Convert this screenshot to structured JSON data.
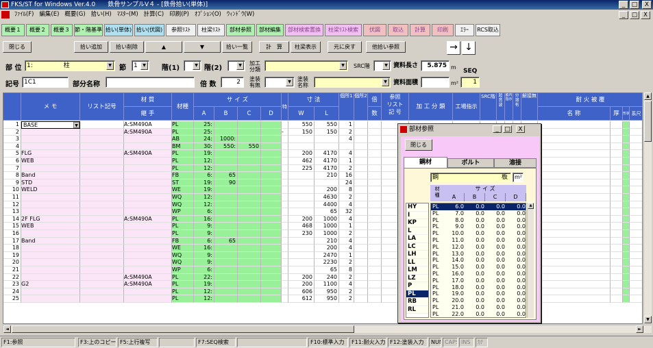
{
  "window": {
    "title": "FKS/ST for Windows Ver.4.0　　鉄骨サンプルV４ - [鉄骨拾い(単体)]",
    "controls": [
      "_",
      "□",
      "X"
    ],
    "child_controls": [
      "_",
      "□",
      "X"
    ]
  },
  "menu": [
    "ﾌｧｲﾙ(F)",
    "編集(E)",
    "概要(G)",
    "拾い(H)",
    "ﾏｽﾀｰ(M)",
    "計算(C)",
    "印刷(P)",
    "ｵﾌﾟｼｮﾝ(O)",
    "ｳｨﾝﾄﾞｳ(W)"
  ],
  "tabs": [
    {
      "label": "概要１",
      "color": "#b0f0b0"
    },
    {
      "label": "概要２",
      "color": "#b0f0b0"
    },
    {
      "label": "概要３",
      "color": "#b0f0b0"
    },
    {
      "label": "節・階基準",
      "color": "#b0f0b0"
    },
    {
      "label": "拾い(単体)",
      "color": "#b0e0f0"
    },
    {
      "label": "拾い(伏図)",
      "color": "#b0e0f0"
    },
    {
      "label": "参照ﾘｽﾄ",
      "color": "#f0f0f0"
    },
    {
      "label": "柱梁ﾘｽﾄ",
      "color": "#f0f0f0"
    },
    {
      "label": "部材参照",
      "color": "#b0f0b0"
    },
    {
      "label": "部材編集",
      "color": "#b0f0b0"
    },
    {
      "label": "部材検索置換",
      "color": "#f0c0f0"
    },
    {
      "label": "柱梁ﾘｽﾄ検索",
      "color": "#f0c0f0"
    },
    {
      "label": "伏図",
      "color": "#f0c0c0"
    },
    {
      "label": "取込",
      "color": "#f0c0c0"
    },
    {
      "label": "計算",
      "color": "#f0c0c0"
    },
    {
      "label": "印刷",
      "color": "#f0c0c0"
    },
    {
      "label": "ｴﾗｰ",
      "color": "#f0f0f0"
    },
    {
      "label": "RCS取込",
      "color": "#f0f0f0"
    }
  ],
  "toolbar": {
    "close": "閉じる",
    "add": "拾い追加",
    "delete": "拾い削除",
    "up": "▲",
    "down": "▼",
    "list": "拾い一覧",
    "calc": "計　算",
    "show": "柱梁表示",
    "undo": "元に戻す",
    "other": "他拾い参照",
    "nav_right": "→",
    "nav_down": "↓"
  },
  "form": {
    "buzai_label": "部 位",
    "buzai_value": "1:　　　　　柱",
    "setsu_label": "節",
    "setsu_value": "1",
    "kai1_label": "階(1)",
    "kai2_label": "階(2)",
    "kako_label": "加工\n分類",
    "src_label": "SRC階",
    "shiryo_len_label": "資料長さ",
    "shiryo_len_value": "5.875",
    "len_unit": "m",
    "seq_label": "SEQ",
    "seq_value": "1",
    "kigou_label": "記号",
    "kigou_value": "1C1",
    "bubun_label": "部分名称",
    "baisu_label": "倍 数",
    "baisu_value": "2",
    "tosou_label": "塗装\n有無",
    "tosou2_label": "塗装\n名称",
    "shiryo_area_label": "資料面積",
    "area_unit": "m²"
  },
  "grid": {
    "headers": {
      "memo": "メ モ",
      "list": "リスト記号",
      "zaishitsu": "材 質",
      "tsugite": "継 手",
      "zaishu": "材種",
      "size": "サ イ ズ",
      "A": "A",
      "B": "B",
      "C": "C",
      "D": "D",
      "tokui": "特",
      "sunpo": "寸 法",
      "W": "W",
      "L": "L",
      "kasho1": "個所1",
      "kasho2": "個所2",
      "bai": "倍",
      "su": "数",
      "sansho": "参照\nリスト\n記 号",
      "kako": "加 工 分 類",
      "genko": "工場指示",
      "src": "SRC階",
      "chokoku": "超音波",
      "shintai": "脇内指示",
      "bunkatsu": "分溶有",
      "kaiten": "解接無",
      "taika": "耐 火 被 覆",
      "meisho": "名 称",
      "atsu": "厚",
      "keishiki": "形状",
      "keijo": "系尺"
    },
    "rows": [
      {
        "n": "1",
        "memo": "BASE",
        "zai": "A:SM490A",
        "sh": "PL",
        "A": "25:",
        "B": "",
        "C": "",
        "D": "",
        "tk": "",
        "W": "550",
        "L": "550",
        "k1": "1"
      },
      {
        "n": "2",
        "memo": "",
        "zai": "A:SM490A",
        "sh": "PL",
        "A": "25:",
        "B": "",
        "C": "",
        "D": "",
        "tk": "-",
        "W": "150",
        "L": "150",
        "k1": "2"
      },
      {
        "n": "3",
        "memo": "",
        "zai": "",
        "sh": "AB",
        "A": "24:",
        "B": "1000:",
        "C": "",
        "D": "",
        "tk": "",
        "W": "",
        "L": "",
        "k1": "4"
      },
      {
        "n": "4",
        "memo": "",
        "zai": "",
        "sh": "BM",
        "A": "30:",
        "B": "550:",
        "C": "550",
        "D": "",
        "tk": "",
        "W": "",
        "L": "",
        "k1": ""
      },
      {
        "n": "5",
        "memo": "FLG",
        "zai": "A:SM490A",
        "sh": "PL",
        "A": "19:",
        "B": "",
        "C": "",
        "D": "",
        "tk": "",
        "W": "200",
        "L": "4170",
        "k1": "4"
      },
      {
        "n": "6",
        "memo": "WEB",
        "zai": "",
        "sh": "PL",
        "A": "12:",
        "B": "",
        "C": "",
        "D": "",
        "tk": "",
        "W": "462",
        "L": "4170",
        "k1": "1"
      },
      {
        "n": "7",
        "memo": "",
        "zai": "",
        "sh": "PL",
        "A": "12:",
        "B": "",
        "C": "",
        "D": "",
        "tk": "",
        "W": "225",
        "L": "4170",
        "k1": "2"
      },
      {
        "n": "8",
        "memo": "Band",
        "zai": "",
        "sh": "FB",
        "A": "6:",
        "B": "65",
        "C": "",
        "D": "",
        "tk": "",
        "W": "",
        "L": "210",
        "k1": "16"
      },
      {
        "n": "9",
        "memo": "STD",
        "zai": "",
        "sh": "ST",
        "A": "19:",
        "B": "90",
        "C": "",
        "D": "",
        "tk": "",
        "W": "",
        "L": "",
        "k1": "24"
      },
      {
        "n": "10",
        "memo": "WELD",
        "zai": "",
        "sh": "WE",
        "A": "19:",
        "B": "",
        "C": "",
        "D": "",
        "tk": "",
        "W": "",
        "L": "200",
        "k1": "8"
      },
      {
        "n": "11",
        "memo": "",
        "zai": "",
        "sh": "WQ",
        "A": "12:",
        "B": "",
        "C": "",
        "D": "",
        "tk": "",
        "W": "",
        "L": "4630",
        "k1": "2"
      },
      {
        "n": "12",
        "memo": "",
        "zai": "",
        "sh": "WQ",
        "A": "12:",
        "B": "",
        "C": "",
        "D": "",
        "tk": "",
        "W": "",
        "L": "4400",
        "k1": "4"
      },
      {
        "n": "13",
        "memo": "",
        "zai": "",
        "sh": "WP",
        "A": "6:",
        "B": "",
        "C": "",
        "D": "",
        "tk": "",
        "W": "",
        "L": "65",
        "k1": "32"
      },
      {
        "n": "14",
        "memo": "2F FLG",
        "zai": "A:SM490A",
        "sh": "PL",
        "A": "16:",
        "B": "",
        "C": "",
        "D": "",
        "tk": "",
        "W": "200",
        "L": "1000",
        "k1": "4"
      },
      {
        "n": "15",
        "memo": "WEB",
        "zai": "",
        "sh": "PL",
        "A": "9:",
        "B": "",
        "C": "",
        "D": "",
        "tk": "",
        "W": "468",
        "L": "1000",
        "k1": "1"
      },
      {
        "n": "16",
        "memo": "",
        "zai": "",
        "sh": "PL",
        "A": "9:",
        "B": "",
        "C": "",
        "D": "",
        "tk": "",
        "W": "230",
        "L": "1000",
        "k1": "2"
      },
      {
        "n": "17",
        "memo": "Band",
        "zai": "",
        "sh": "FB",
        "A": "6:",
        "B": "65",
        "C": "",
        "D": "",
        "tk": "",
        "W": "",
        "L": "210",
        "k1": "4"
      },
      {
        "n": "18",
        "memo": "",
        "zai": "",
        "sh": "WE",
        "A": "16:",
        "B": "",
        "C": "",
        "D": "",
        "tk": "",
        "W": "",
        "L": "200",
        "k1": "4"
      },
      {
        "n": "19",
        "memo": "",
        "zai": "",
        "sh": "WQ",
        "A": "9:",
        "B": "",
        "C": "",
        "D": "",
        "tk": "",
        "W": "",
        "L": "2470",
        "k1": "1"
      },
      {
        "n": "20",
        "memo": "",
        "zai": "",
        "sh": "WQ",
        "A": "9:",
        "B": "",
        "C": "",
        "D": "",
        "tk": "",
        "W": "",
        "L": "2230",
        "k1": "2"
      },
      {
        "n": "21",
        "memo": "",
        "zai": "",
        "sh": "WP",
        "A": "6:",
        "B": "",
        "C": "",
        "D": "",
        "tk": "",
        "W": "",
        "L": "65",
        "k1": "8"
      },
      {
        "n": "22",
        "memo": "",
        "zai": "A:SM490A",
        "sh": "PL",
        "A": "22:",
        "B": "",
        "C": "",
        "D": "",
        "tk": "",
        "W": "200",
        "L": "240",
        "k1": "2"
      },
      {
        "n": "23",
        "memo": "G2",
        "zai": "A:SM490A",
        "sh": "PL",
        "A": "19:",
        "B": "",
        "C": "",
        "D": "",
        "tk": "",
        "W": "200",
        "L": "1100",
        "k1": "4"
      },
      {
        "n": "24",
        "memo": "",
        "zai": "",
        "sh": "PL",
        "A": "12:",
        "B": "",
        "C": "",
        "D": "",
        "tk": "",
        "W": "606",
        "L": "950",
        "k1": "2"
      },
      {
        "n": "25",
        "memo": "",
        "zai": "",
        "sh": "PL",
        "A": "12:",
        "B": "",
        "C": "",
        "D": "",
        "tk": "",
        "W": "612",
        "L": "950",
        "k1": "2"
      }
    ]
  },
  "popup": {
    "title": "部材参照",
    "close": "閉じる",
    "tabs": [
      "鋼材",
      "ボルト",
      "溶接"
    ],
    "field_value": "鋼",
    "field_suffix": "板",
    "unit": "m²",
    "col_zaishu": "材\n種",
    "col_size": "サ イ ズ",
    "cols": [
      "A",
      "B",
      "C",
      "D"
    ],
    "types": [
      "HY",
      "I",
      "KP",
      "L",
      "LA",
      "LC",
      "LH",
      "LL",
      "LM",
      "LZ",
      "P",
      "PL",
      "RB",
      "RL"
    ],
    "selected_type": "PL",
    "rows": [
      [
        "PL",
        "6.0",
        "0.0",
        "0.0",
        "0.0"
      ],
      [
        "PL",
        "7.0",
        "0.0",
        "0.0",
        "0.0"
      ],
      [
        "PL",
        "8.0",
        "0.0",
        "0.0",
        "0.0"
      ],
      [
        "PL",
        "9.0",
        "0.0",
        "0.0",
        "0.0"
      ],
      [
        "PL",
        "10.0",
        "0.0",
        "0.0",
        "0.0"
      ],
      [
        "PL",
        "11.0",
        "0.0",
        "0.0",
        "0.0"
      ],
      [
        "PL",
        "12.0",
        "0.0",
        "0.0",
        "0.0"
      ],
      [
        "PL",
        "13.0",
        "0.0",
        "0.0",
        "0.0"
      ],
      [
        "PL",
        "14.0",
        "0.0",
        "0.0",
        "0.0"
      ],
      [
        "PL",
        "15.0",
        "0.0",
        "0.0",
        "0.0"
      ],
      [
        "PL",
        "16.0",
        "0.0",
        "0.0",
        "0.0"
      ],
      [
        "PL",
        "17.0",
        "0.0",
        "0.0",
        "0.0"
      ],
      [
        "PL",
        "18.0",
        "0.0",
        "0.0",
        "0.0"
      ],
      [
        "PL",
        "19.0",
        "0.0",
        "0.0",
        "0.0"
      ],
      [
        "PL",
        "20.0",
        "0.0",
        "0.0",
        "0.0"
      ],
      [
        "PL",
        "21.0",
        "0.0",
        "0.0",
        "0.0"
      ],
      [
        "PL",
        "22.0",
        "0.0",
        "0.0",
        "0.0"
      ]
    ]
  },
  "status": [
    "F1:参照",
    "",
    "F3:上のコピー",
    "F5:上行複写",
    "",
    "F7:SEQ検索",
    "",
    "F10:標準入力",
    "F11:耐火入力",
    "F12:塗装入力",
    "NUM",
    "CAPS",
    "INS",
    "ｶﾅ"
  ]
}
